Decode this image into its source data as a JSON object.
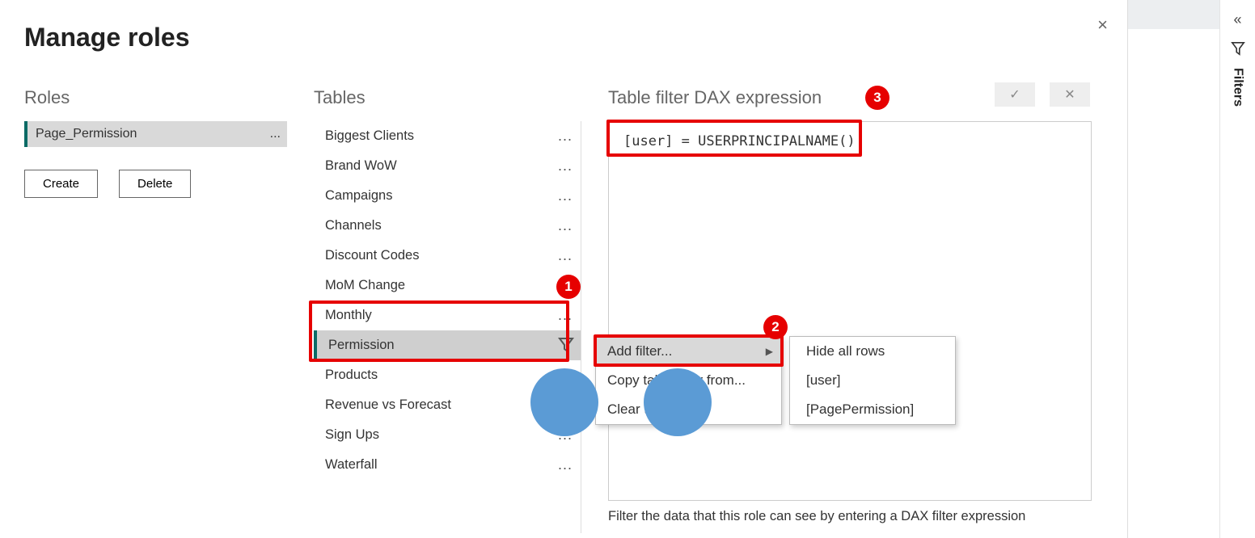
{
  "dialog": {
    "title": "Manage roles",
    "close_icon": "×"
  },
  "columns": {
    "roles": "Roles",
    "tables": "Tables",
    "dax": "Table filter DAX expression"
  },
  "roles": {
    "selected": {
      "name": "Page_Permission",
      "more": "..."
    },
    "create_label": "Create",
    "delete_label": "Delete"
  },
  "tables": {
    "items": [
      {
        "name": "Biggest Clients"
      },
      {
        "name": "Brand WoW"
      },
      {
        "name": "Campaigns"
      },
      {
        "name": "Channels"
      },
      {
        "name": "Discount Codes"
      },
      {
        "name": "MoM Change"
      },
      {
        "name": "Monthly"
      },
      {
        "name": "Permission",
        "selected": true
      },
      {
        "name": "Products"
      },
      {
        "name": "Revenue vs Forecast"
      },
      {
        "name": "Sign Ups"
      },
      {
        "name": "Waterfall"
      }
    ],
    "more": "..."
  },
  "dax": {
    "expression": "[user] = USERPRINCIPALNAME()",
    "help": "Filter the data that this role can see by entering a DAX filter expression"
  },
  "action": {
    "check": "✓",
    "cancel": "✕"
  },
  "context": {
    "add_filter": "Add filter...",
    "copy_from": "Copy table filter from...",
    "clear": "Clear table filter",
    "sub": {
      "hide_all": "Hide all rows",
      "user": "[user]",
      "page_perm": "[PagePermission]"
    }
  },
  "callouts": {
    "c1": "1",
    "c2": "2",
    "c3": "3"
  },
  "filters_rail": {
    "label": "Filters"
  }
}
